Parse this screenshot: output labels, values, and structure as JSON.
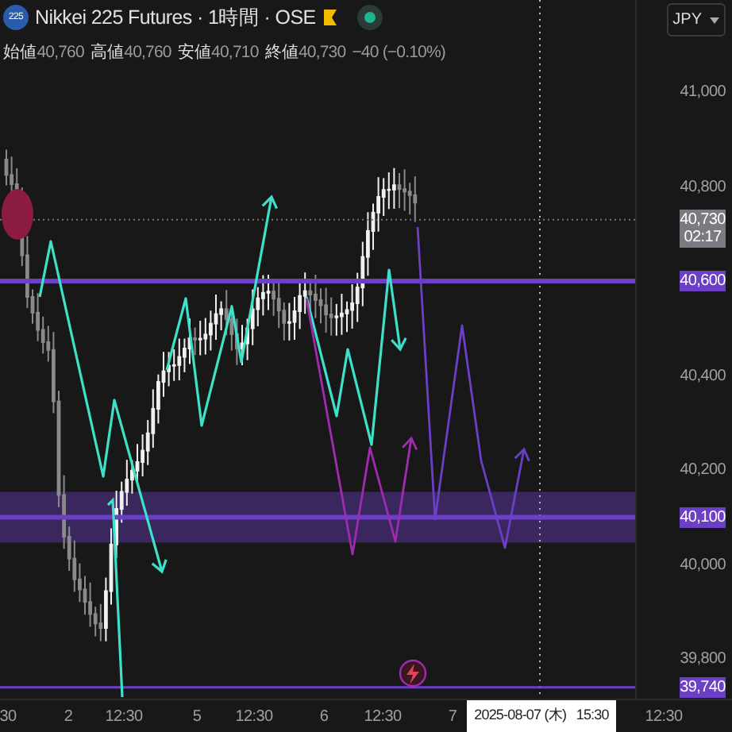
{
  "header": {
    "symbol_badge": "225",
    "title": "Nikkei 225 Futures · 1時間 · OSE",
    "currency": "JPY"
  },
  "ohlc": [
    {
      "label": "始値",
      "value": "40,760"
    },
    {
      "label": "高値",
      "value": "40,760"
    },
    {
      "label": "安値",
      "value": "40,710"
    },
    {
      "label": "終値",
      "value": "40,730"
    }
  ],
  "change": "−40 (−0.10%)",
  "price_axis": {
    "ticks": [
      "41,000",
      "40,800",
      "40,400",
      "40,200",
      "40,000",
      "39,800"
    ],
    "markers": [
      {
        "kind": "last",
        "price": "40,730",
        "countdown": "02:17"
      },
      {
        "kind": "level",
        "price": "40,600"
      },
      {
        "kind": "level",
        "price": "40,100"
      },
      {
        "kind": "level",
        "price": "39,740"
      }
    ]
  },
  "time_axis": {
    "labels": [
      "30",
      "2",
      "12:30",
      "5",
      "12:30",
      "6",
      "12:30",
      "7",
      "12:30"
    ],
    "crosshair_label": "2025-08-07 (木)   15:30"
  }
}
